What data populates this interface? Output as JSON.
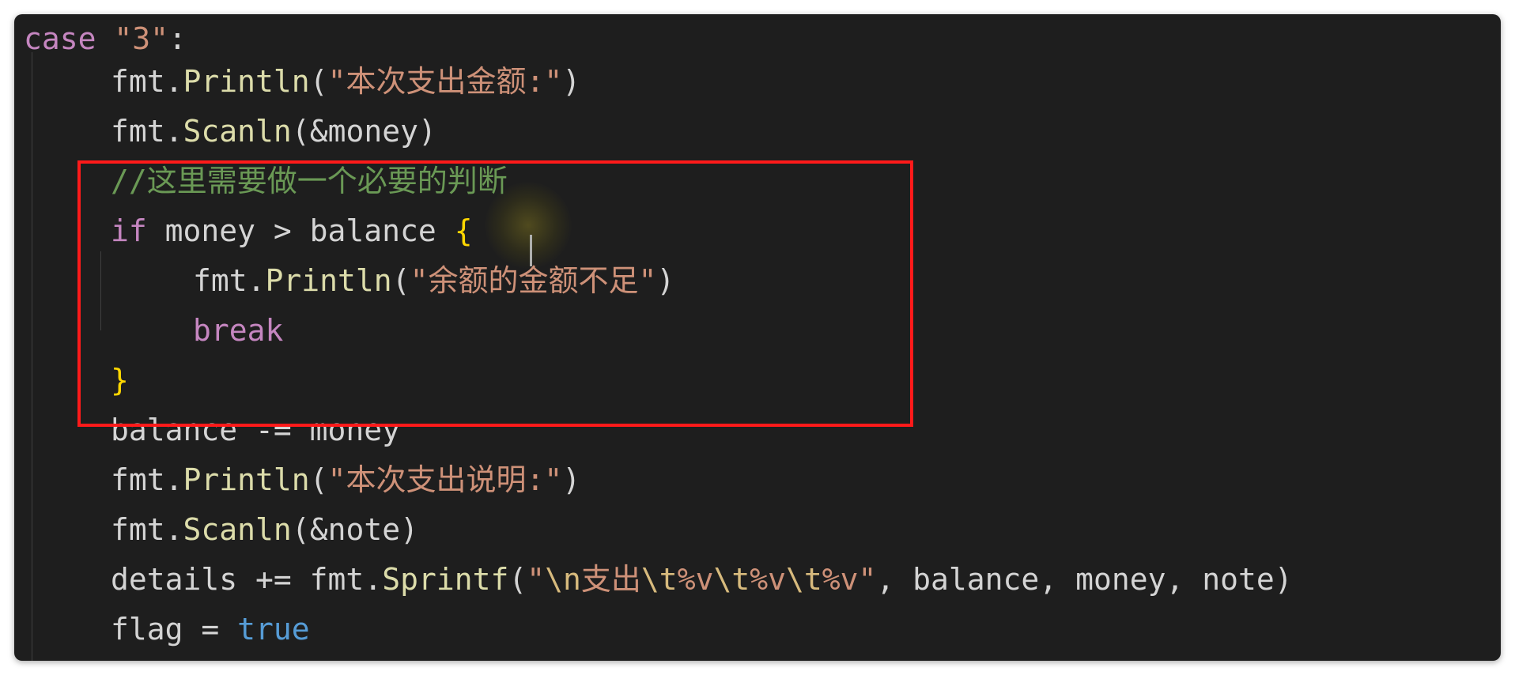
{
  "code": {
    "line1": {
      "kw": "case",
      "sp": " ",
      "str": "\"3\"",
      "colon": ":"
    },
    "line2": {
      "obj": "fmt",
      "dot": ".",
      "fn": "Println",
      "open": "(",
      "str": "\"本次支出金额:\"",
      "close": ")"
    },
    "line3": {
      "obj": "fmt",
      "dot": ".",
      "fn": "Scanln",
      "open": "(",
      "arg": "&money",
      "close": ")"
    },
    "line4": {
      "comment": "//这里需要做一个必要的判断"
    },
    "line5": {
      "kw": "if",
      "cond": " money > balance ",
      "brace": "{"
    },
    "line6": {
      "obj": "fmt",
      "dot": ".",
      "fn": "Println",
      "open": "(",
      "str": "\"余额的金额不足\"",
      "close": ")"
    },
    "line7": {
      "kw": "break"
    },
    "line8": {
      "brace": "}"
    },
    "line9": {
      "text": "balance -= money"
    },
    "line10": {
      "obj": "fmt",
      "dot": ".",
      "fn": "Println",
      "open": "(",
      "str": "\"本次支出说明:\"",
      "close": ")"
    },
    "line11": {
      "obj": "fmt",
      "dot": ".",
      "fn": "Scanln",
      "open": "(",
      "arg": "&note",
      "close": ")"
    },
    "line12": {
      "pre": "details += ",
      "obj": "fmt",
      "dot": ".",
      "fn": "Sprintf",
      "open": "(",
      "q1": "\"",
      "e1": "\\n",
      "s1": "支出",
      "e2": "\\t",
      "s2": "%v",
      "e3": "\\t",
      "s3": "%v",
      "e4": "\\t",
      "s4": "%v",
      "q2": "\"",
      "rest": ", balance, money, note",
      "close": ")"
    },
    "line13": {
      "var": "flag",
      "op": " = ",
      "val": "true"
    }
  },
  "colors": {
    "background": "#1e1e1e",
    "keyword_control": "#c586c0",
    "keyword_literal": "#569cd6",
    "string": "#ce9178",
    "function": "#dcdcaa",
    "comment": "#6a9955",
    "bracket": "#ffd700",
    "annotation_box": "#ff1a1a"
  }
}
